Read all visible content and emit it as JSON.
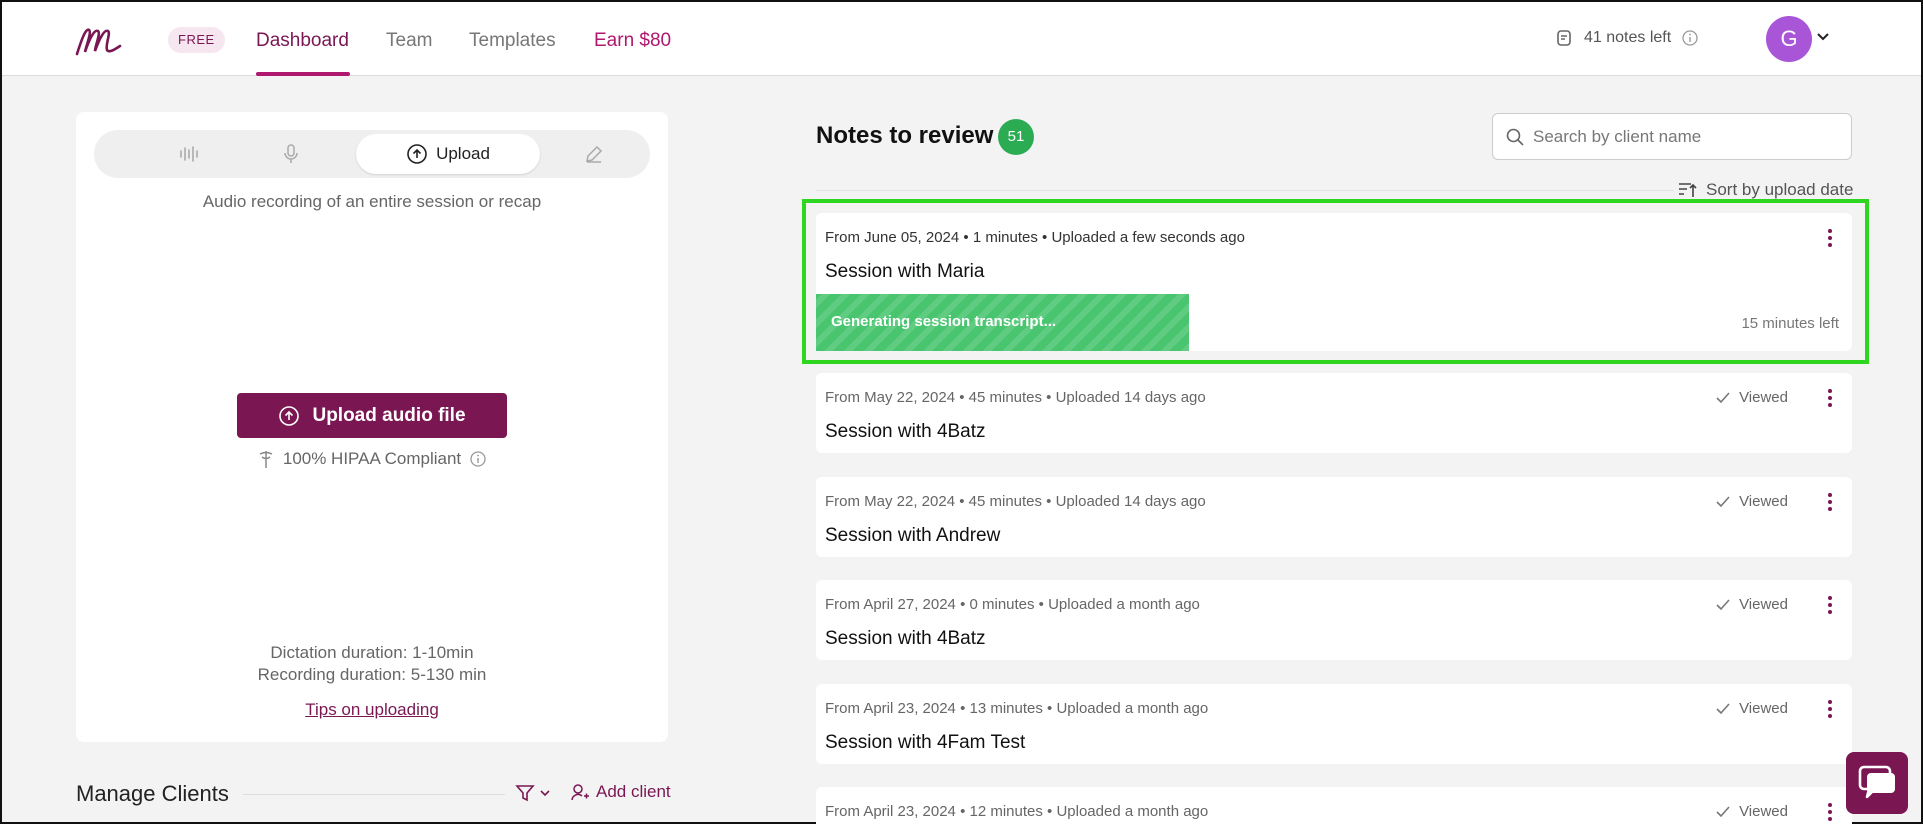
{
  "header": {
    "plan_badge": "FREE",
    "nav": [
      {
        "label": "Dashboard"
      },
      {
        "label": "Team"
      },
      {
        "label": "Templates"
      },
      {
        "label": "Earn $80"
      }
    ],
    "notes_left": "41 notes left",
    "avatar_initial": "G"
  },
  "left": {
    "tabs": {
      "active_label": "Upload"
    },
    "description": "Audio recording of an entire session or recap",
    "upload_button": "Upload audio file",
    "hipaa": "100% HIPAA Compliant",
    "dictation_duration": "Dictation duration: 1-10min",
    "recording_duration": "Recording duration: 5-130 min",
    "tips_link": "Tips on uploading",
    "manage_clients": "Manage Clients",
    "add_client": "Add client"
  },
  "notes": {
    "title": "Notes to review",
    "count": "51",
    "search_placeholder": "Search by client name",
    "sort_label": "Sort by upload date",
    "viewed_label": "Viewed",
    "items": [
      {
        "meta": "From June 05, 2024 • 1 minutes • Uploaded a few seconds ago",
        "title": "Session with Maria",
        "status": "Generating session transcript...",
        "time_left": "15 minutes left"
      },
      {
        "meta": "From May 22, 2024 • 45 minutes • Uploaded 14 days ago",
        "title": "Session with 4Batz"
      },
      {
        "meta": "From May 22, 2024 • 45 minutes • Uploaded 14 days ago",
        "title": "Session with Andrew"
      },
      {
        "meta": "From April 27, 2024 • 0 minutes • Uploaded a month ago",
        "title": "Session with 4Batz"
      },
      {
        "meta": "From April 23, 2024 • 13 minutes • Uploaded a month ago",
        "title": "Session with 4Fam Test"
      },
      {
        "meta": "From April 23, 2024 • 12 minutes • Uploaded a month ago",
        "title": ""
      }
    ]
  },
  "colors": {
    "brand": "#7a1753",
    "accent": "#b0176e",
    "success": "#2bac53",
    "progress": "#49c570",
    "highlight": "#2ed61f"
  }
}
